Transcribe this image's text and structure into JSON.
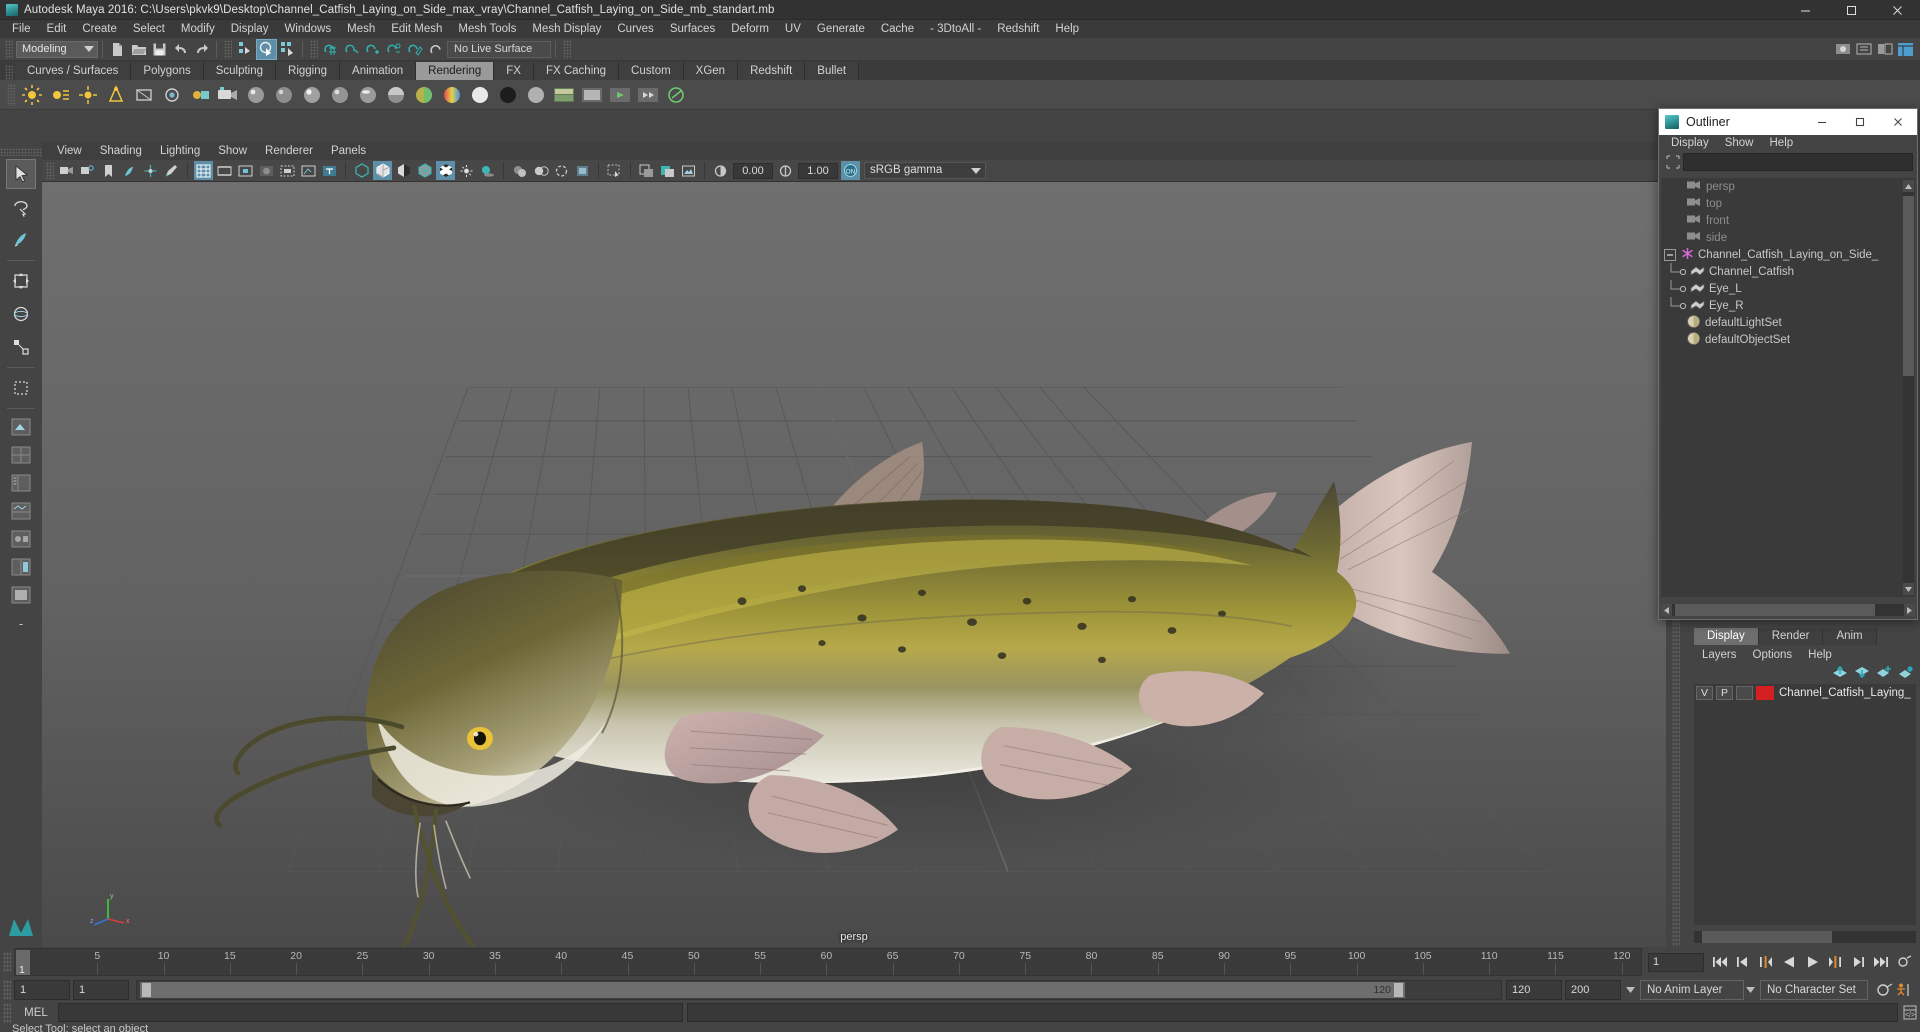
{
  "window": {
    "title": "Autodesk Maya 2016: C:\\Users\\pkvk9\\Desktop\\Channel_Catfish_Laying_on_Side_max_vray\\Channel_Catfish_Laying_on_Side_mb_standart.mb",
    "minimize": "–",
    "maximize": "☐",
    "close": "✕"
  },
  "menubar": [
    "File",
    "Edit",
    "Create",
    "Select",
    "Modify",
    "Display",
    "Windows",
    "Mesh",
    "Edit Mesh",
    "Mesh Tools",
    "Mesh Display",
    "Curves",
    "Surfaces",
    "Deform",
    "UV",
    "Generate",
    "Cache",
    "- 3DtoAll -",
    "Redshift",
    "Help"
  ],
  "statusline": {
    "menuset": "Modeling",
    "live_surface": "No Live Surface"
  },
  "shelf_tabs": [
    {
      "label": "Curves / Surfaces",
      "active": false
    },
    {
      "label": "Polygons",
      "active": false
    },
    {
      "label": "Sculpting",
      "active": false
    },
    {
      "label": "Rigging",
      "active": false
    },
    {
      "label": "Animation",
      "active": false
    },
    {
      "label": "Rendering",
      "active": true
    },
    {
      "label": "FX",
      "active": false
    },
    {
      "label": "FX Caching",
      "active": false
    },
    {
      "label": "Custom",
      "active": false
    },
    {
      "label": "XGen",
      "active": false
    },
    {
      "label": "Redshift",
      "active": false
    },
    {
      "label": "Bullet",
      "active": false
    }
  ],
  "viewport": {
    "menus": [
      "View",
      "Shading",
      "Lighting",
      "Show",
      "Renderer",
      "Panels"
    ],
    "exposure": "0.00",
    "gamma_value": "1.00",
    "color_transform": "sRGB gamma",
    "camera_label": "persp",
    "axis": {
      "x": "x",
      "y": "y",
      "z": "z"
    }
  },
  "outliner": {
    "title": "Outliner",
    "menus": [
      "Display",
      "Show",
      "Help"
    ],
    "search_value": "",
    "search_placeholder": "",
    "items": [
      {
        "label": "persp",
        "icon": "camera-icon",
        "indent": 1,
        "dim": true
      },
      {
        "label": "top",
        "icon": "camera-icon",
        "indent": 1,
        "dim": true
      },
      {
        "label": "front",
        "icon": "camera-icon",
        "indent": 1,
        "dim": true
      },
      {
        "label": "side",
        "icon": "camera-icon",
        "indent": 1,
        "dim": true
      },
      {
        "label": "Channel_Catfish_Laying_on_Side_",
        "icon": "transform-icon",
        "indent": 0,
        "dim": false,
        "expander": "−"
      },
      {
        "label": "Channel_Catfish",
        "icon": "mesh-icon",
        "indent": 2,
        "dim": false
      },
      {
        "label": "Eye_L",
        "icon": "mesh-icon",
        "indent": 2,
        "dim": false
      },
      {
        "label": "Eye_R",
        "icon": "mesh-icon",
        "indent": 2,
        "dim": false
      },
      {
        "label": "defaultLightSet",
        "icon": "set-icon",
        "indent": 1,
        "dim": false
      },
      {
        "label": "defaultObjectSet",
        "icon": "set-icon",
        "indent": 1,
        "dim": false
      }
    ]
  },
  "rightdock": {
    "tabs": [
      {
        "label": "Display",
        "active": true
      },
      {
        "label": "Render",
        "active": false
      },
      {
        "label": "Anim",
        "active": false
      }
    ],
    "menus": [
      "Layers",
      "Options",
      "Help"
    ],
    "layers": [
      {
        "v": "V",
        "p": "P",
        "third": "",
        "color": "#d42020",
        "name": "Channel_Catfish_Laying_"
      }
    ]
  },
  "timeline": {
    "start_visible": 1,
    "current_frame": "1",
    "tick_labels": [
      5,
      10,
      15,
      20,
      25,
      30,
      35,
      40,
      45,
      50,
      55,
      60,
      65,
      70,
      75,
      80,
      85,
      90,
      95,
      100,
      105,
      110,
      115,
      120
    ],
    "tick_max": 120,
    "playback_current": "1"
  },
  "rangeslider": {
    "anim_start": "1",
    "range_start": "1",
    "range_end_label": "120",
    "range_field_start": "120",
    "range_field_end": "200",
    "anim_layer": "No Anim Layer",
    "character_set": "No Character Set"
  },
  "command": {
    "label": "MEL",
    "input_value": "",
    "output_value": ""
  },
  "statusbar": {
    "help_text": "Select Tool: select an object"
  },
  "colors": {
    "accent_blue": "#5d8fa8",
    "teal": "#31b3b3",
    "orange": "#e08a2e",
    "layer_red": "#d42020",
    "panel_bg": "#444444",
    "tab_active": "#9a9a9a"
  }
}
